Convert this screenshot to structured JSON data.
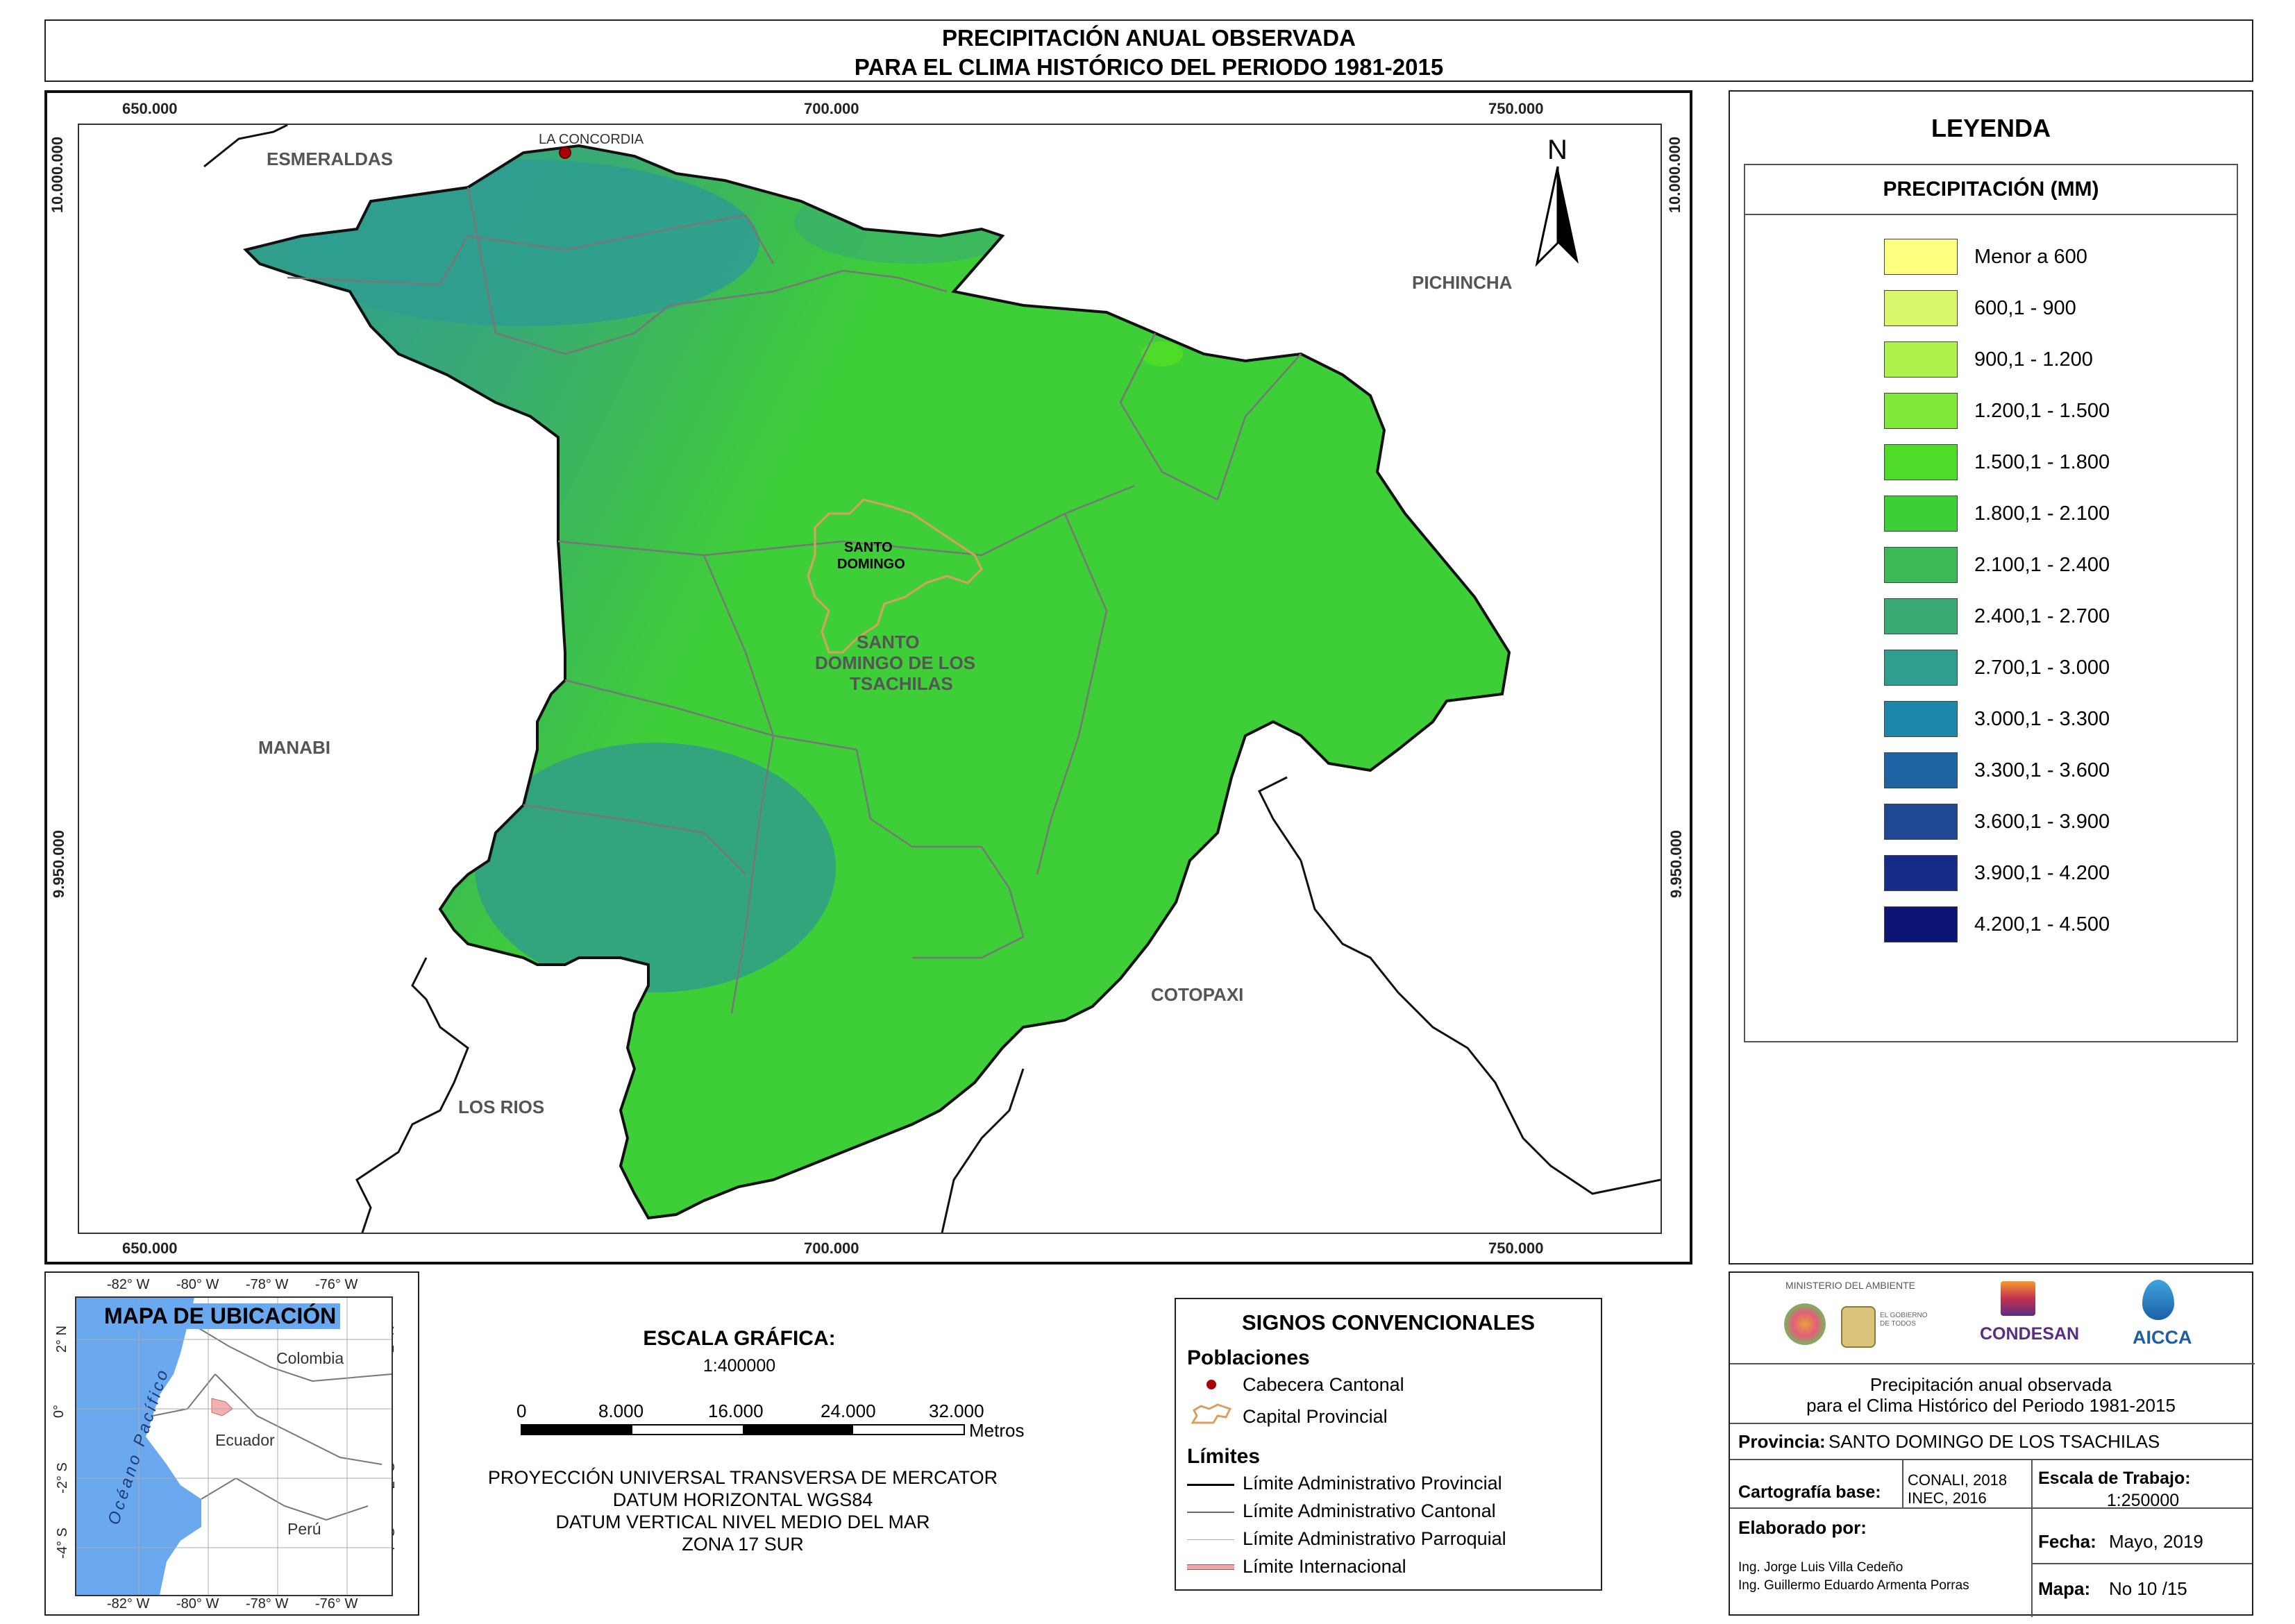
{
  "title": {
    "line1": "PRECIPITACIÓN ANUAL OBSERVADA",
    "line2": "PARA EL CLIMA HISTÓRICO DEL PERIODO 1981-2015"
  },
  "map": {
    "x_ticks_top": [
      "650.000",
      "700.000",
      "750.000"
    ],
    "x_ticks_bottom": [
      "650.000",
      "700.000",
      "750.000"
    ],
    "y_ticks_left": [
      "10.000.000",
      "9.950.000"
    ],
    "y_ticks_right": [
      "10.000.000",
      "9.950.000"
    ],
    "north": "N",
    "labels": {
      "esmeraldas": "ESMERALDAS",
      "la_concordia": "LA CONCORDIA",
      "pichincha": "PICHINCHA",
      "santo_domingo": [
        "SANTO",
        "DOMINGO"
      ],
      "province": [
        "SANTO",
        "DOMINGO DE LOS",
        "TSACHILAS"
      ],
      "manabi": "MANABI",
      "cotopaxi": "COTOPAXI",
      "los_rios": "LOS RIOS"
    }
  },
  "legend": {
    "title": "LEYENDA",
    "subtitle": "PRECIPITACIÓN (MM)",
    "items": [
      {
        "label": "Menor a 600",
        "color": "#ffff80"
      },
      {
        "label": "600,1 - 900",
        "color": "#d9f76a"
      },
      {
        "label": "900,1 - 1.200",
        "color": "#adf24a"
      },
      {
        "label": "1.200,1 - 1.500",
        "color": "#7fe83a"
      },
      {
        "label": "1.500,1 - 1.800",
        "color": "#4fdc28"
      },
      {
        "label": "1.800,1 - 2.100",
        "color": "#3ecf38"
      },
      {
        "label": "2.100,1 - 2.400",
        "color": "#3cba55"
      },
      {
        "label": "2.400,1 - 2.700",
        "color": "#3aaa74"
      },
      {
        "label": "2.700,1 - 3.000",
        "color": "#2f9d90"
      },
      {
        "label": "3.000,1 - 3.300",
        "color": "#1c87a8"
      },
      {
        "label": "3.300,1 - 3.600",
        "color": "#1f64a2"
      },
      {
        "label": "3.600,1 - 3.900",
        "color": "#1f4792"
      },
      {
        "label": "3.900,1 - 4.200",
        "color": "#172c86"
      },
      {
        "label": "4.200,1 - 4.500",
        "color": "#0c1573"
      }
    ]
  },
  "location_map": {
    "title": "MAPA DE UBICACIÓN",
    "lon_ticks": [
      "-82° W",
      "-80° W",
      "-78° W",
      "-76° W"
    ],
    "lat_ticks": [
      "2° N",
      "0°",
      "-2° S",
      "-4° S"
    ],
    "labels": {
      "ocean": "Océano Pacífico",
      "colombia": "Colombia",
      "ecuador": "Ecuador",
      "peru": "Perú"
    }
  },
  "scale": {
    "title": "ESCALA GRÁFICA:",
    "ratio": "1:400000",
    "ticks": [
      "0",
      "8.000",
      "16.000",
      "24.000",
      "32.000"
    ],
    "unit": "Metros",
    "projection": [
      "PROYECCIÓN UNIVERSAL TRANSVERSA DE MERCATOR",
      "DATUM HORIZONTAL WGS84",
      "DATUM VERTICAL NIVEL MEDIO DEL MAR",
      "ZONA 17 SUR"
    ]
  },
  "signs": {
    "title": "SIGNOS CONVENCIONALES",
    "poblaciones": "Poblaciones",
    "cabecera": "Cabecera Cantonal",
    "capital": "Capital Provincial",
    "limites": "Límites",
    "lim_provincial": "Límite Administrativo Provincial",
    "lim_cantonal": "Límite Administrativo Cantonal",
    "lim_parroquial": "Límite Administrativo Parroquial",
    "lim_internacional": "Límite Internacional"
  },
  "info": {
    "logos": {
      "ministerio": "MINISTERIO DEL AMBIENTE",
      "condesan": "CONDESAN",
      "aicca": "AICCA",
      "gobierno": "EL GOBIERNO DE TODOS"
    },
    "desc_line1": "Precipitación anual observada",
    "desc_line2": "para el Clima Histórico del Periodo 1981-2015",
    "provincia_label": "Provincia:",
    "provincia_value": "SANTO DOMINGO DE LOS TSACHILAS",
    "cartografia_label": "Cartografía base:",
    "cartografia_value1": "CONALI, 2018",
    "cartografia_value2": "INEC, 2016",
    "escala_label": "Escala de Trabajo:",
    "escala_value": "1:250000",
    "elaborado_label": "Elaborado por:",
    "elaborado_1": "Ing. Jorge Luis Villa Cedeño",
    "elaborado_2": "Ing. Guillermo Eduardo Armenta Porras",
    "fecha_label": "Fecha:",
    "fecha_value": "Mayo, 2019",
    "mapa_label": "Mapa:",
    "mapa_value": "No 10 /15"
  }
}
